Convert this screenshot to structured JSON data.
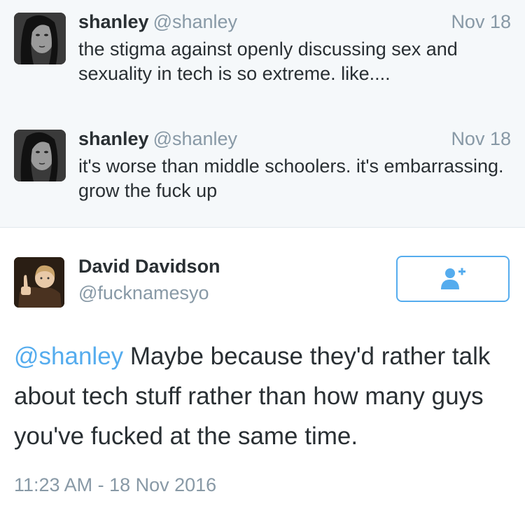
{
  "thread": [
    {
      "name": "shanley",
      "handle": "@shanley",
      "date": "Nov 18",
      "text": "the stigma against openly discussing sex and sexuality in tech is so extreme. like...."
    },
    {
      "name": "shanley",
      "handle": "@shanley",
      "date": "Nov 18",
      "text": "it's worse than middle schoolers. it's embarrassing. grow the fuck up"
    }
  ],
  "main_tweet": {
    "name": "David Davidson",
    "handle": "@fucknamesyo",
    "follow_icon": "add-user-icon",
    "mention": "@shanley",
    "text": " Maybe because they'd rather talk about tech stuff rather than how many guys you've fucked at the same time.",
    "timestamp": "11:23 AM - 18 Nov 2016"
  },
  "colors": {
    "accent": "#55acee",
    "muted": "#8899a6",
    "text": "#292f33",
    "thread_bg": "#f5f8fa"
  }
}
